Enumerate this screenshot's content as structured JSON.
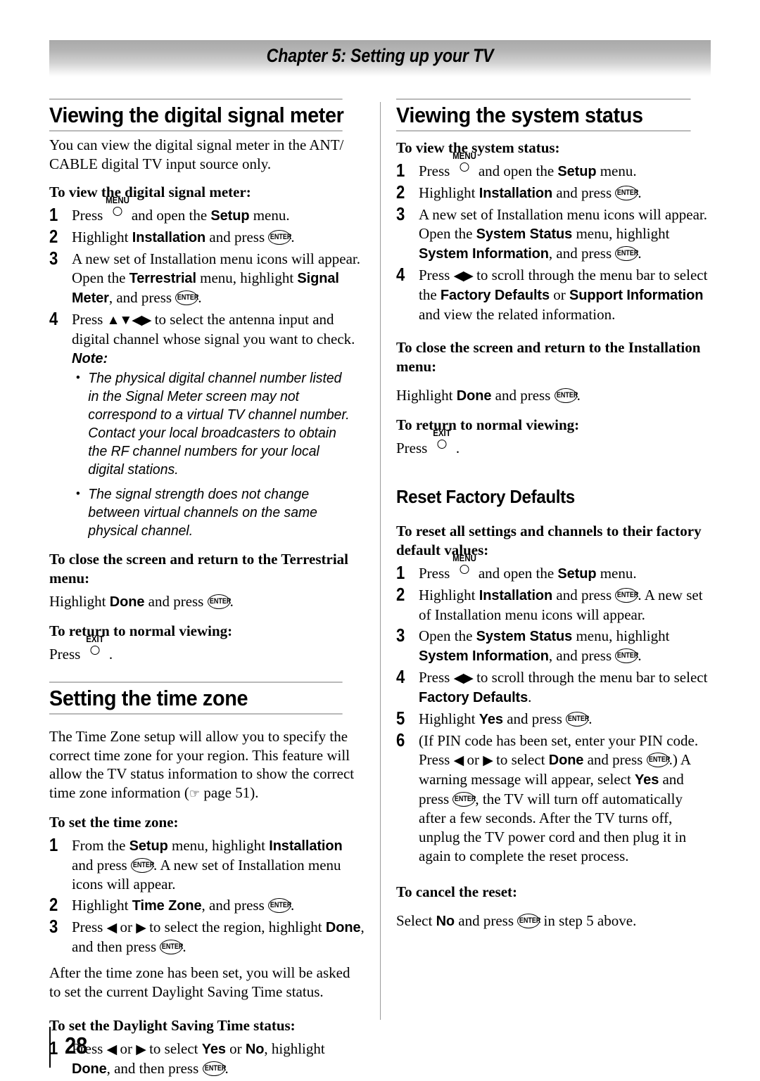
{
  "chapter": {
    "title": "Chapter 5: Setting up your TV"
  },
  "keys": {
    "menu_label": "MENU",
    "exit_label": "EXIT",
    "enter_label": "ENTER"
  },
  "glyphs": {
    "up": "▲",
    "down": "▼",
    "left": "◀",
    "right": "▶",
    "bullet": "•",
    "hand": "☞"
  },
  "left_column": {
    "section1": {
      "heading": "Viewing the digital signal meter",
      "intro": "You can view the digital signal meter in the ANT/ CABLE digital TV input source only.",
      "sub1": "To view the digital signal meter:",
      "step1": {
        "num": "1",
        "a": "Press ",
        "b": " and open the ",
        "ui1": "Setup",
        "c": " menu."
      },
      "step2": {
        "num": "2",
        "a": "Highlight ",
        "ui1": "Installation",
        "b": " and press ",
        "c": "."
      },
      "step3": {
        "num": "3",
        "a": "A new set of Installation menu icons will appear. Open the ",
        "ui1": "Terrestrial",
        "b": " menu, highlight ",
        "ui2": "Signal Meter",
        "c": ", and press ",
        "d": "."
      },
      "step4": {
        "num": "4",
        "a": "Press ",
        "b": " to select the antenna input and digital channel whose signal you want to check."
      },
      "note_label": "Note:",
      "note_items": [
        "The physical digital channel number listed in the Signal Meter screen may not correspond to a virtual TV channel number. Contact your local broadcasters to obtain the RF channel numbers for your local digital stations.",
        "The signal strength does not change between virtual channels on the same physical channel."
      ],
      "sub2": "To close the screen and return to the Terrestrial menu:",
      "close_text": {
        "a": "Highlight ",
        "ui1": "Done",
        "b": " and press ",
        "c": "."
      },
      "sub3": "To return to normal viewing:",
      "exit_text": {
        "a": "Press ",
        "b": " ."
      }
    },
    "section2": {
      "heading": "Setting the time zone",
      "intro_a": "The Time Zone setup will allow you to specify the correct time zone for your region. This feature will allow the TV status information to show the correct time zone information (",
      "intro_b": " page 51).",
      "sub1": "To set the time zone:",
      "step1": {
        "num": "1",
        "a": "From the ",
        "ui1": "Setup",
        "b": " menu, highlight ",
        "ui2": "Installation",
        "c": " and press ",
        "d": ". A new set of Installation menu icons will appear."
      },
      "step2": {
        "num": "2",
        "a": "Highlight ",
        "ui1": "Time Zone",
        "b": ", and press ",
        "c": "."
      },
      "step3": {
        "num": "3",
        "a": "Press ",
        "b": " or ",
        "c": " to select the region, highlight ",
        "ui1": "Done",
        "d": ", and then press ",
        "e": "."
      },
      "after_text": "After the time zone has been set, you will be asked to set the current Daylight Saving Time status.",
      "sub2": "To set the Daylight Saving Time status:",
      "dst_step1": {
        "num": "1",
        "a": "Press ",
        "b": " or ",
        "c": " to select ",
        "ui1": "Yes",
        "d": " or ",
        "ui2": "No",
        "e": ", highlight ",
        "ui3": "Done",
        "f": ", and then press ",
        "g": "."
      }
    }
  },
  "right_column": {
    "section1": {
      "heading": "Viewing the system status",
      "sub1": "To view the system status:",
      "step1": {
        "num": "1",
        "a": "Press ",
        "b": " and open the ",
        "ui1": "Setup",
        "c": " menu."
      },
      "step2": {
        "num": "2",
        "a": "Highlight ",
        "ui1": "Installation",
        "b": " and press ",
        "c": "."
      },
      "step3": {
        "num": "3",
        "a": "A new set of Installation menu icons will appear. Open the ",
        "ui1": "System Status",
        "b": " menu, highlight ",
        "ui2": "System Information",
        "c": ", and press ",
        "d": "."
      },
      "step4": {
        "num": "4",
        "a": "Press ",
        "b": " to scroll through the menu bar to select the ",
        "ui1": "Factory Defaults",
        "c": " or ",
        "ui2": "Support Information",
        "d": " and view the related information."
      },
      "sub2": "To close the screen and return to the Installation menu:",
      "close_text": {
        "a": "Highlight ",
        "ui1": "Done",
        "b": " and press ",
        "c": "."
      },
      "sub3": "To return to normal viewing:",
      "exit_text": {
        "a": "Press ",
        "b": " ."
      }
    },
    "section2": {
      "heading": "Reset Factory Defaults",
      "sub1": "To reset all settings and channels to their factory default values:",
      "step1": {
        "num": "1",
        "a": "Press ",
        "b": " and open the ",
        "ui1": "Setup",
        "c": " menu."
      },
      "step2": {
        "num": "2",
        "a": "Highlight ",
        "ui1": "Installation",
        "b": " and press ",
        "c": ". A new set of Installation menu icons will appear."
      },
      "step3": {
        "num": "3",
        "a": "Open the ",
        "ui1": "System Status",
        "b": " menu, highlight ",
        "ui2": "System Information",
        "c": ", and press ",
        "d": "."
      },
      "step4": {
        "num": "4",
        "a": "Press ",
        "b": " to scroll through the menu bar to select ",
        "ui1": "Factory Defaults",
        "c": "."
      },
      "step5": {
        "num": "5",
        "a": "Highlight ",
        "ui1": "Yes",
        "b": " and press ",
        "c": "."
      },
      "step6": {
        "num": "6",
        "a": "(If PIN code has been set, enter your PIN code. Press ",
        "b": " or ",
        "c": " to select ",
        "ui1": "Done",
        "d": " and press ",
        "e": ".) A warning message will appear, select ",
        "ui2": "Yes",
        "f": " and press ",
        "g": ", the TV will turn off automatically after a few seconds. After the TV turns off, unplug the TV power cord and then plug it in again to complete the reset process."
      },
      "sub2": "To cancel the reset:",
      "cancel_text": {
        "a": "Select ",
        "ui1": "No",
        "b": " and press ",
        "c": " in step 5 above."
      }
    }
  },
  "footer": {
    "page_number": "28"
  }
}
